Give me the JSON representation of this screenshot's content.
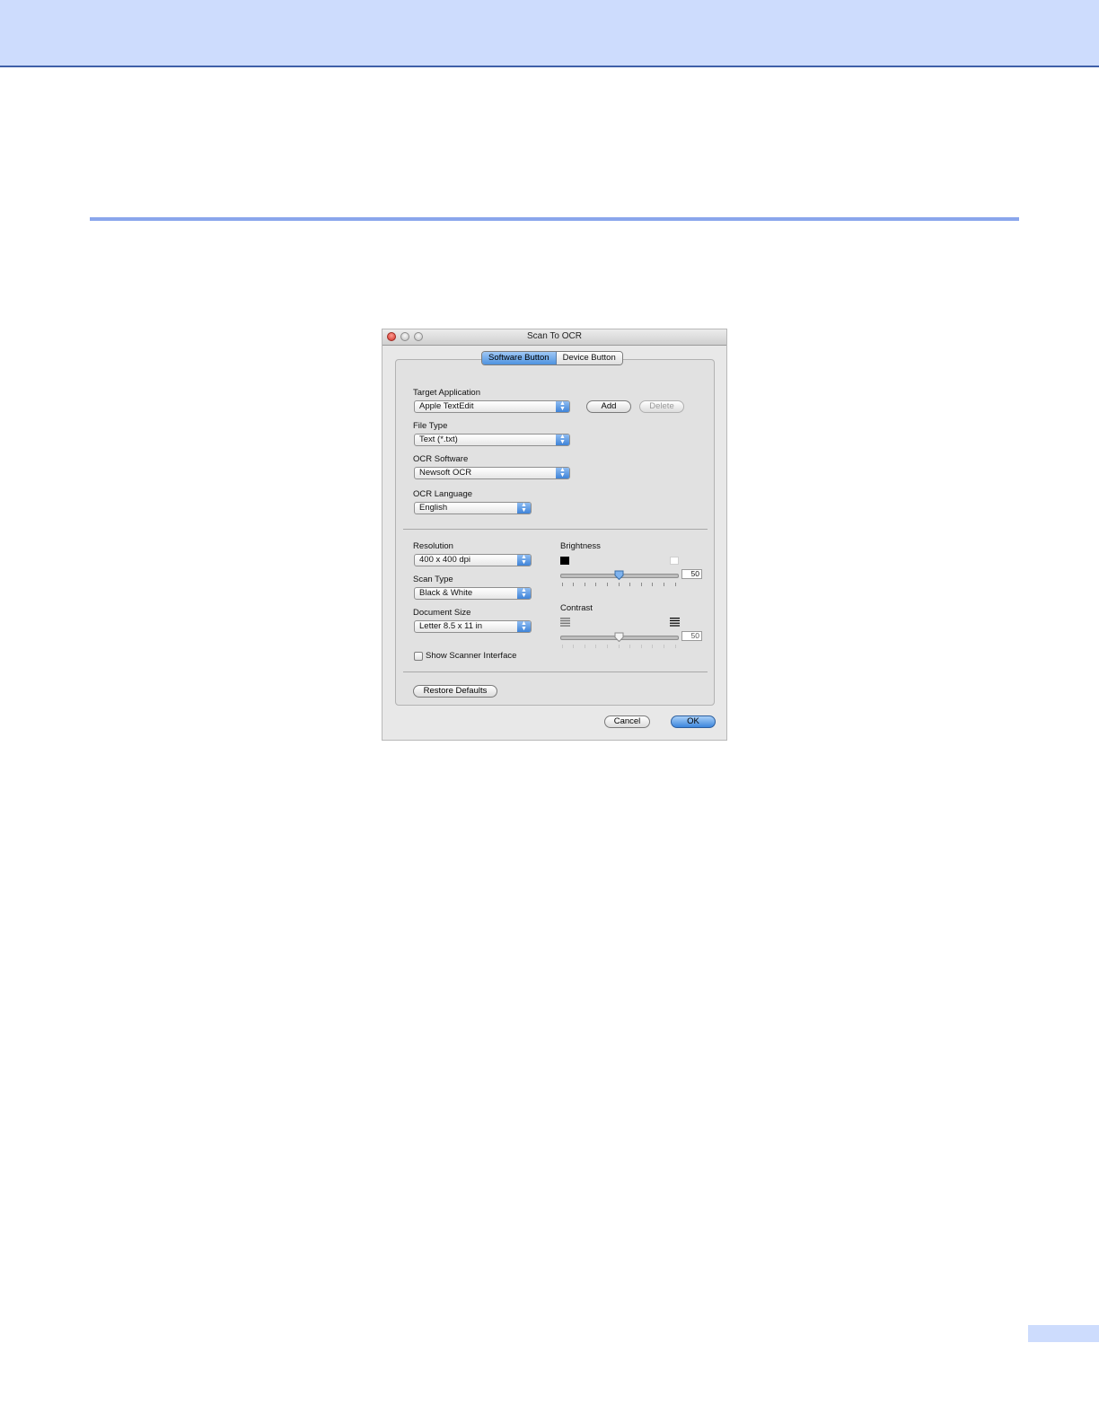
{
  "window": {
    "title": "Scan To OCR",
    "tabs": [
      {
        "label": "Software Button",
        "active": true
      },
      {
        "label": "Device Button",
        "active": false
      }
    ]
  },
  "target_application": {
    "label": "Target Application",
    "value": "Apple TextEdit",
    "add_label": "Add",
    "delete_label": "Delete"
  },
  "file_type": {
    "label": "File Type",
    "value": "Text (*.txt)"
  },
  "ocr_software": {
    "label": "OCR Software",
    "value": "Newsoft OCR"
  },
  "ocr_language": {
    "label": "OCR Language",
    "value": "English"
  },
  "resolution": {
    "label": "Resolution",
    "value": "400 x 400 dpi"
  },
  "scan_type": {
    "label": "Scan Type",
    "value": "Black & White"
  },
  "document_size": {
    "label": "Document Size",
    "value": "Letter  8.5 x 11 in"
  },
  "brightness": {
    "label": "Brightness",
    "value": "50",
    "level": 0.5
  },
  "contrast": {
    "label": "Contrast",
    "value": "50",
    "level": 0.5
  },
  "show_scanner_interface": {
    "label": "Show Scanner Interface",
    "checked": false
  },
  "buttons": {
    "restore_defaults": "Restore Defaults",
    "cancel": "Cancel",
    "ok": "OK"
  },
  "colors": {
    "header_band": "#cddcfd",
    "accent_rule": "#8aa6ec",
    "selected_tab": "#4e93e0"
  }
}
